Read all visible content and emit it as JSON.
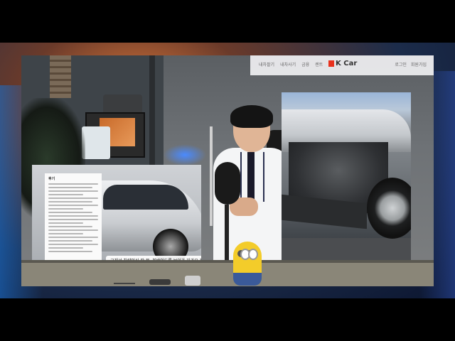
{
  "website": {
    "nav_items": [
      "내차팔기",
      "내차사기",
      "금융",
      "렌트"
    ],
    "logo_text": "K Car",
    "right_items": [
      "로그인",
      "회원가입"
    ],
    "brand_color": "#e8321e"
  },
  "document": {
    "title": "후기"
  },
  "subtitle": {
    "text": "그래서 차량인식 딱 문, 불박인드를 보이가 자가요 지원의 결을 보았다."
  },
  "icons": {
    "logo_mark": "kcar-logo-icon"
  }
}
